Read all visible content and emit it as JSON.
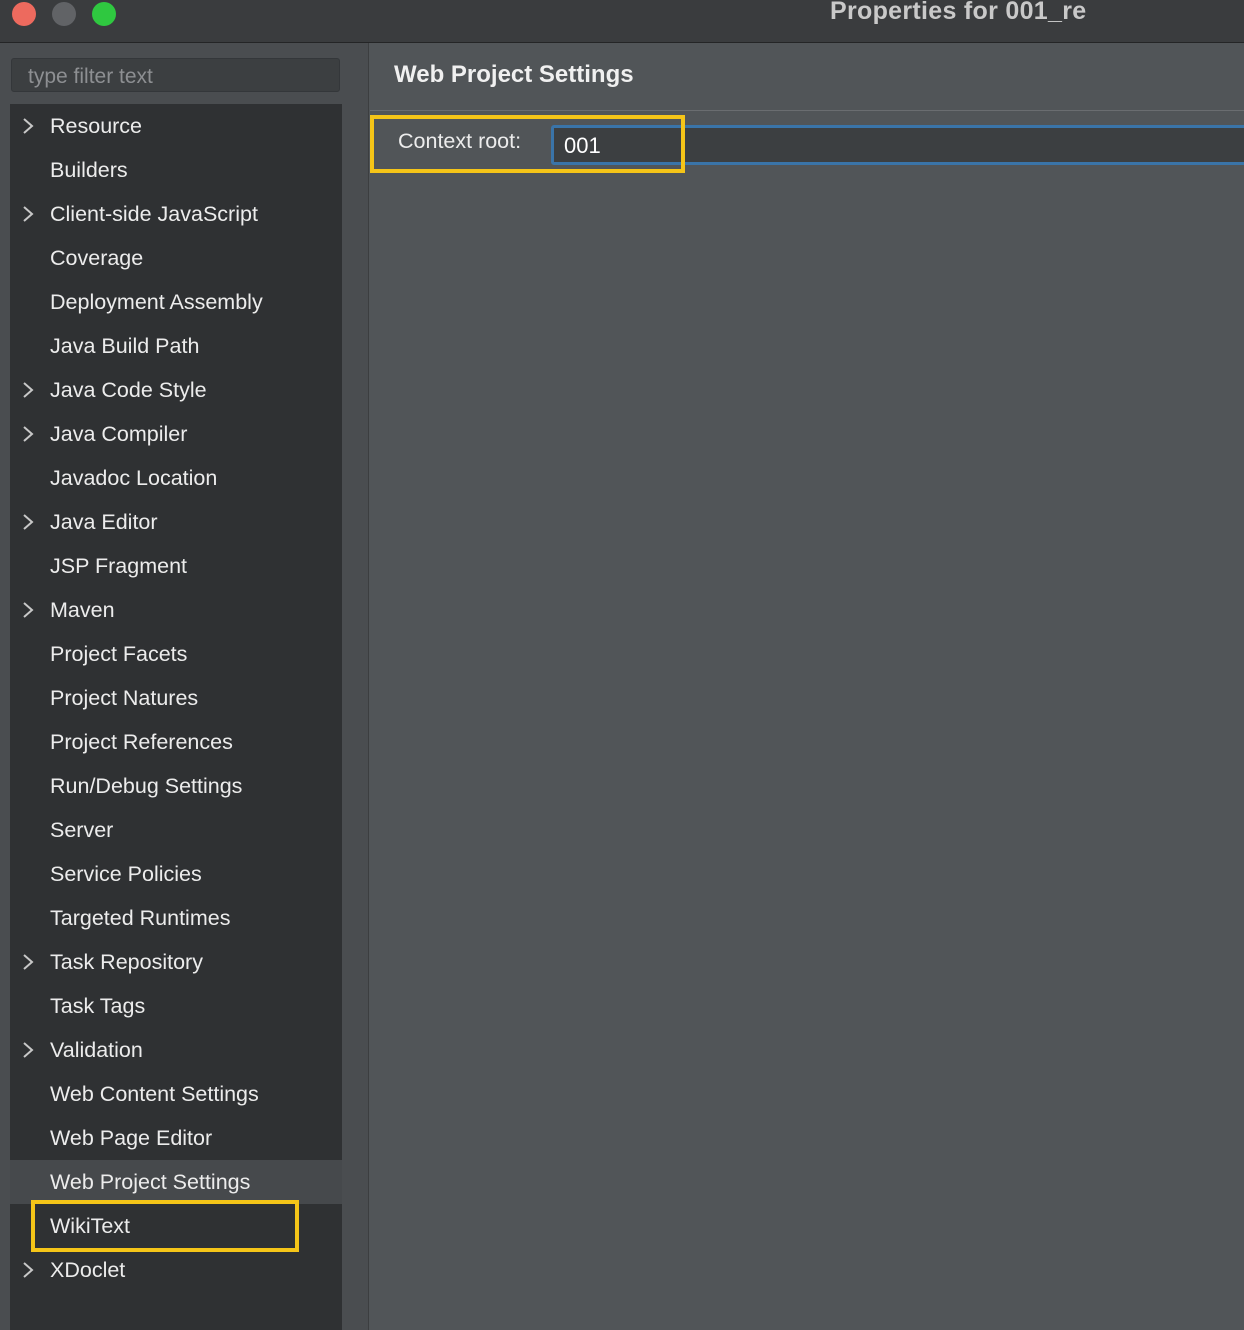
{
  "window": {
    "title": "Properties for 001_re"
  },
  "colors": {
    "highlight": "#f5c518",
    "focus_ring": "#3a74a8",
    "close": "#ed6a5e",
    "zoom": "#2fc840"
  },
  "sidebar": {
    "filter_placeholder": "type filter text",
    "items": [
      {
        "label": "Resource",
        "expandable": true
      },
      {
        "label": "Builders",
        "expandable": false
      },
      {
        "label": "Client-side JavaScript",
        "expandable": true
      },
      {
        "label": "Coverage",
        "expandable": false
      },
      {
        "label": "Deployment Assembly",
        "expandable": false
      },
      {
        "label": "Java Build Path",
        "expandable": false
      },
      {
        "label": "Java Code Style",
        "expandable": true
      },
      {
        "label": "Java Compiler",
        "expandable": true
      },
      {
        "label": "Javadoc Location",
        "expandable": false
      },
      {
        "label": "Java Editor",
        "expandable": true
      },
      {
        "label": "JSP Fragment",
        "expandable": false
      },
      {
        "label": "Maven",
        "expandable": true
      },
      {
        "label": "Project Facets",
        "expandable": false
      },
      {
        "label": "Project Natures",
        "expandable": false
      },
      {
        "label": "Project References",
        "expandable": false
      },
      {
        "label": "Run/Debug Settings",
        "expandable": false
      },
      {
        "label": "Server",
        "expandable": false
      },
      {
        "label": "Service Policies",
        "expandable": false
      },
      {
        "label": "Targeted Runtimes",
        "expandable": false
      },
      {
        "label": "Task Repository",
        "expandable": true
      },
      {
        "label": "Task Tags",
        "expandable": false
      },
      {
        "label": "Validation",
        "expandable": true
      },
      {
        "label": "Web Content Settings",
        "expandable": false
      },
      {
        "label": "Web Page Editor",
        "expandable": false
      },
      {
        "label": "Web Project Settings",
        "expandable": false,
        "selected": true
      },
      {
        "label": "WikiText",
        "expandable": false
      },
      {
        "label": "XDoclet",
        "expandable": true
      }
    ]
  },
  "main": {
    "title": "Web Project Settings",
    "context_root_label": "Context root:",
    "context_root_value": "001"
  }
}
